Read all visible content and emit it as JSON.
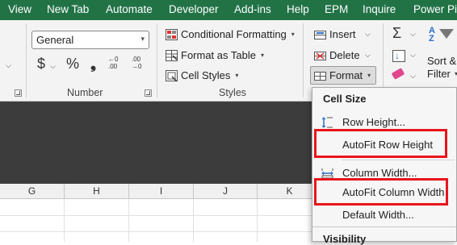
{
  "menubar": {
    "tabs": [
      {
        "label": "View",
        "underline": "false"
      },
      {
        "label": "New Tab"
      },
      {
        "label": "Automate"
      },
      {
        "label": "Developer"
      },
      {
        "label": "Add-ins"
      },
      {
        "label": "Help"
      },
      {
        "label": "EPM"
      },
      {
        "label": "Inquire"
      },
      {
        "label": "Power Piv"
      }
    ]
  },
  "ribbon": {
    "number": {
      "format_value": "General",
      "currency_symbol": "$",
      "percent_symbol": "%",
      "comma_symbol": "❟",
      "increase_decimal": "←0 .00",
      "decrease_decimal": ".00 →0",
      "group_label": "Number"
    },
    "styles": {
      "conditional_formatting": "Conditional Formatting",
      "format_as_table": "Format as Table",
      "cell_styles": "Cell Styles",
      "group_label": "Styles"
    },
    "cells": {
      "insert": "Insert",
      "delete": "Delete",
      "format": "Format"
    },
    "editing": {
      "sort_filter_line1": "Sort &",
      "sort_filter_line2": "Filter"
    }
  },
  "columns": [
    "G",
    "H",
    "I",
    "J",
    "K"
  ],
  "format_menu": {
    "cell_size_heading": "Cell Size",
    "row_height": "Row Height...",
    "autofit_row_height": "AutoFit Row Height",
    "column_width": "Column Width...",
    "autofit_column_width": "AutoFit Column Width",
    "default_width": "Default Width...",
    "visibility_heading": "Visibility"
  },
  "colors": {
    "menubar_bg": "#217346",
    "highlight": "#e8151b",
    "formula_area": "#3c3c3c"
  }
}
